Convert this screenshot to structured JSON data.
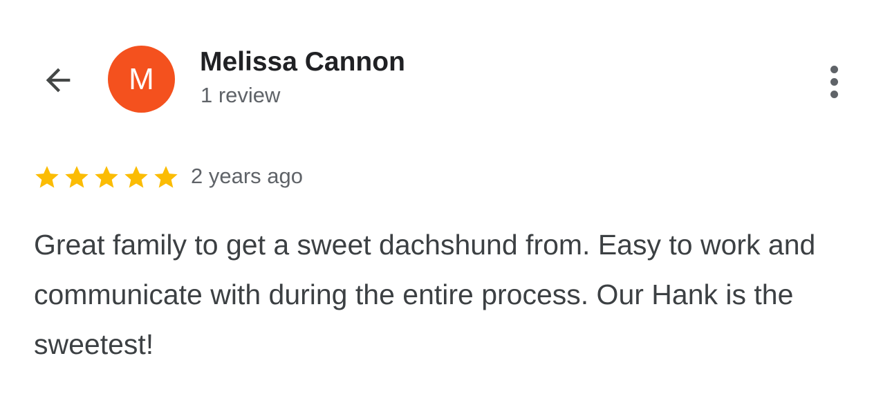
{
  "header": {
    "back_icon": "arrow-left-icon",
    "avatar_letter": "M",
    "avatar_color": "#f4511e",
    "reviewer_name": "Melissa Cannon",
    "review_count": "1 review",
    "menu_icon": "more-vertical-icon"
  },
  "review": {
    "rating": 5,
    "max_rating": 5,
    "star_color": "#fbbc04",
    "date": "2 years ago",
    "text": "Great family to get a sweet dachshund from. Easy to work and communicate with during the entire process. Our Hank is the sweetest!"
  }
}
